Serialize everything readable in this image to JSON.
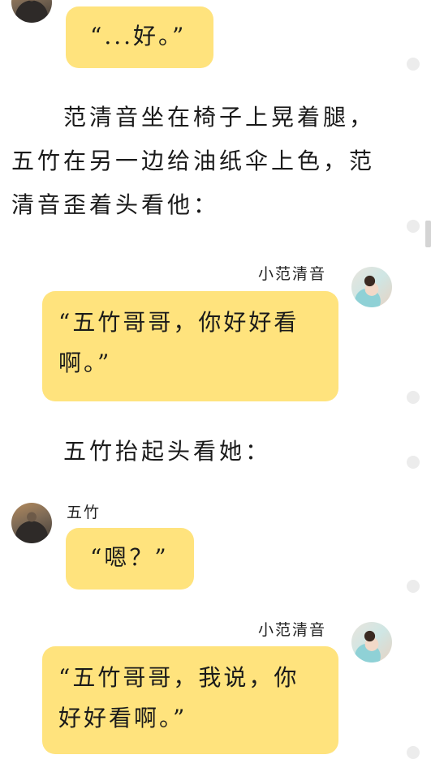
{
  "chat": {
    "top_bubble": "“...好。”",
    "narration_1": "　　范清音坐在椅子上晃着腿，五竹在另一边给油纸伞上色，范清音歪着头看他：",
    "xiaofan_name_1": "小范清音",
    "xiaofan_bubble_1": "“五竹哥哥，你好好看啊。”",
    "narration_2": "　　五竹抬起头看她：",
    "wuzhu_name": "五竹",
    "wuzhu_bubble": "“嗯？”",
    "xiaofan_name_2": "小范清音",
    "xiaofan_bubble_2": "“五竹哥哥，我说，你好好看啊。”"
  },
  "avatars": {
    "wuzhu": "wuzhu-avatar",
    "xiaofan": "xiaofan-avatar"
  },
  "colors": {
    "bubble": "#ffe37d",
    "background": "#ffffff",
    "text": "#1a1a1a"
  }
}
